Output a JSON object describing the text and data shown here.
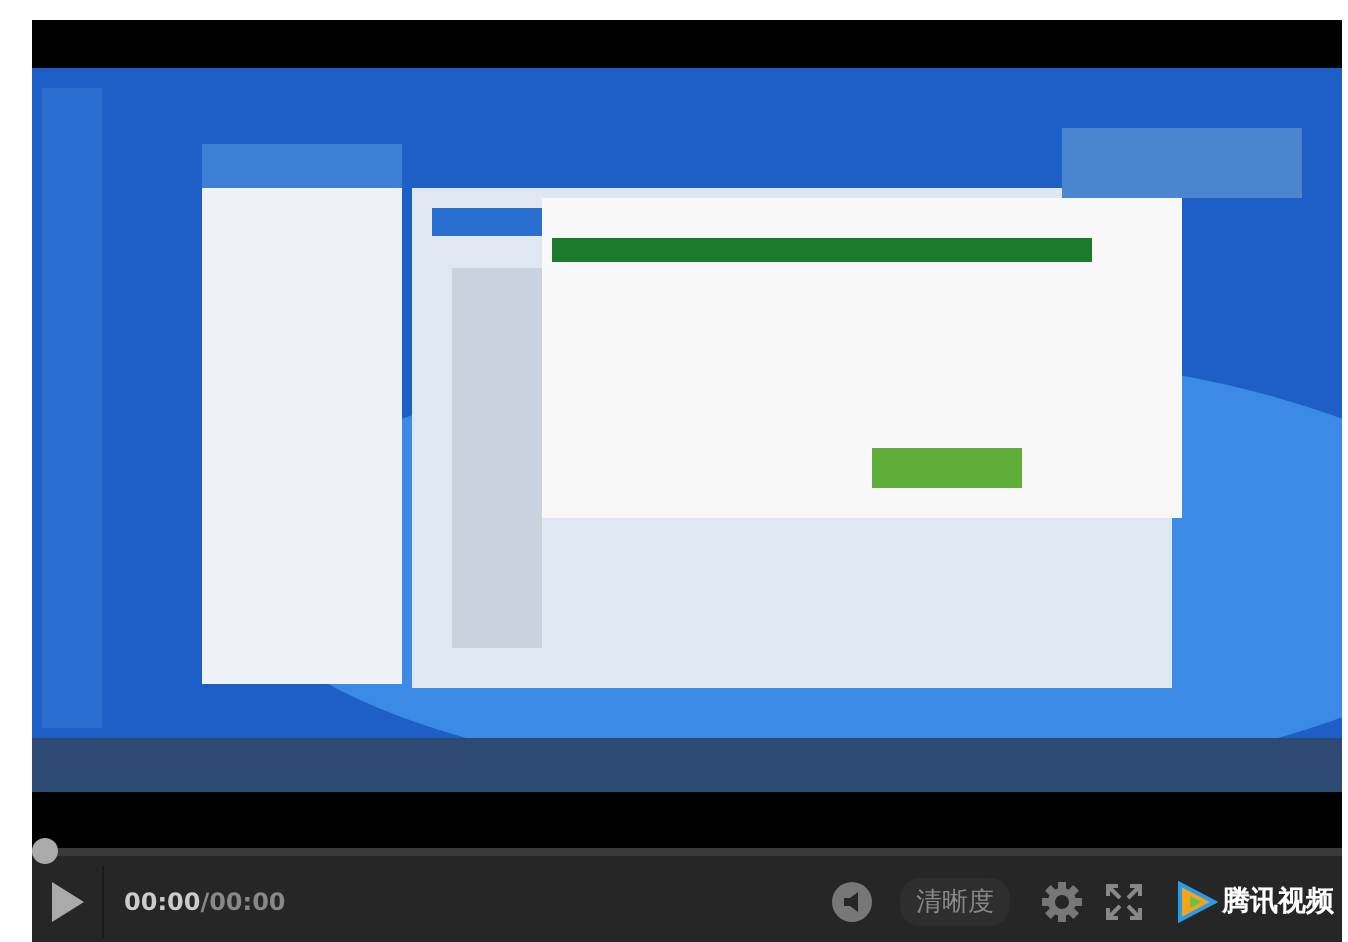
{
  "player": {
    "progress": {
      "level": 0
    },
    "current_time": "00:00",
    "duration": "/00:00",
    "quality_button": "清晰度",
    "brand": "腾讯视频"
  }
}
